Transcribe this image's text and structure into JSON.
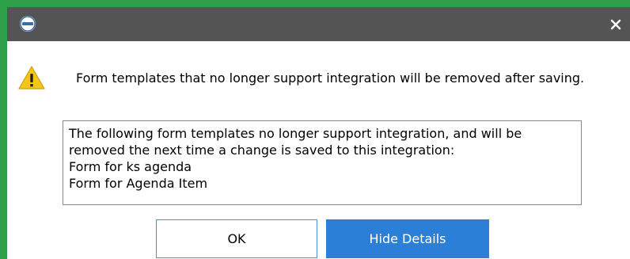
{
  "titlebar": {
    "app_icon": "onbase-logo-icon",
    "close_icon": "close-icon",
    "close_glyph": "✕"
  },
  "dialog": {
    "icon": "warning-icon",
    "message": "Form templates that no longer support integration will be removed after saving.",
    "details_lines": [
      "The following form templates no longer support integration, and will be",
      "removed the next time a change is saved to this integration:",
      "Form for ks agenda",
      "Form for Agenda Item"
    ]
  },
  "buttons": {
    "ok_label": "OK",
    "hide_details_label": "Hide Details"
  },
  "colors": {
    "titlebar": "#545454",
    "window_border": "#2e9e48",
    "primary_button": "#2b7fd6",
    "warning": "#f5c518"
  }
}
